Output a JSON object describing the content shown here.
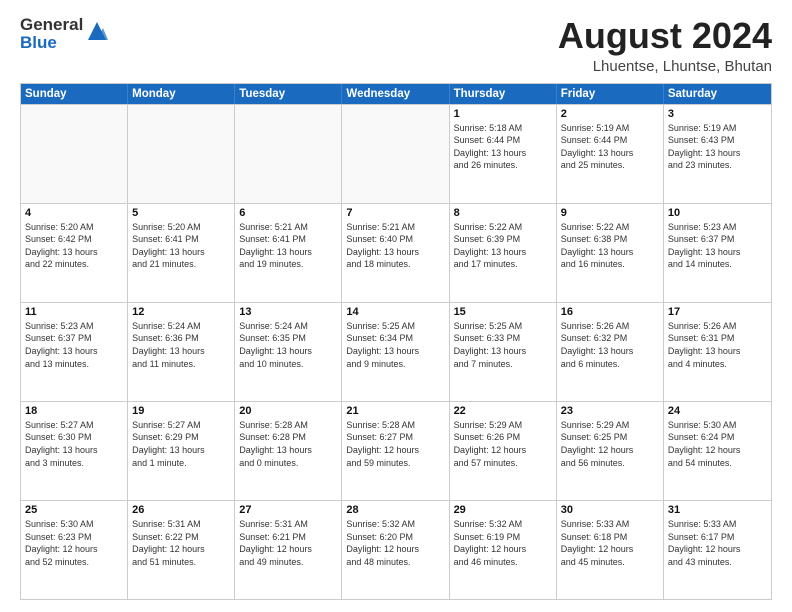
{
  "header": {
    "logo_line1": "General",
    "logo_line2": "Blue",
    "title": "August 2024",
    "subtitle": "Lhuentse, Lhuntse, Bhutan"
  },
  "days_of_week": [
    "Sunday",
    "Monday",
    "Tuesday",
    "Wednesday",
    "Thursday",
    "Friday",
    "Saturday"
  ],
  "weeks": [
    [
      {
        "day": "",
        "info": "",
        "empty": true
      },
      {
        "day": "",
        "info": "",
        "empty": true
      },
      {
        "day": "",
        "info": "",
        "empty": true
      },
      {
        "day": "",
        "info": "",
        "empty": true
      },
      {
        "day": "1",
        "info": "Sunrise: 5:18 AM\nSunset: 6:44 PM\nDaylight: 13 hours\nand 26 minutes.",
        "empty": false
      },
      {
        "day": "2",
        "info": "Sunrise: 5:19 AM\nSunset: 6:44 PM\nDaylight: 13 hours\nand 25 minutes.",
        "empty": false
      },
      {
        "day": "3",
        "info": "Sunrise: 5:19 AM\nSunset: 6:43 PM\nDaylight: 13 hours\nand 23 minutes.",
        "empty": false
      }
    ],
    [
      {
        "day": "4",
        "info": "Sunrise: 5:20 AM\nSunset: 6:42 PM\nDaylight: 13 hours\nand 22 minutes.",
        "empty": false
      },
      {
        "day": "5",
        "info": "Sunrise: 5:20 AM\nSunset: 6:41 PM\nDaylight: 13 hours\nand 21 minutes.",
        "empty": false
      },
      {
        "day": "6",
        "info": "Sunrise: 5:21 AM\nSunset: 6:41 PM\nDaylight: 13 hours\nand 19 minutes.",
        "empty": false
      },
      {
        "day": "7",
        "info": "Sunrise: 5:21 AM\nSunset: 6:40 PM\nDaylight: 13 hours\nand 18 minutes.",
        "empty": false
      },
      {
        "day": "8",
        "info": "Sunrise: 5:22 AM\nSunset: 6:39 PM\nDaylight: 13 hours\nand 17 minutes.",
        "empty": false
      },
      {
        "day": "9",
        "info": "Sunrise: 5:22 AM\nSunset: 6:38 PM\nDaylight: 13 hours\nand 16 minutes.",
        "empty": false
      },
      {
        "day": "10",
        "info": "Sunrise: 5:23 AM\nSunset: 6:37 PM\nDaylight: 13 hours\nand 14 minutes.",
        "empty": false
      }
    ],
    [
      {
        "day": "11",
        "info": "Sunrise: 5:23 AM\nSunset: 6:37 PM\nDaylight: 13 hours\nand 13 minutes.",
        "empty": false
      },
      {
        "day": "12",
        "info": "Sunrise: 5:24 AM\nSunset: 6:36 PM\nDaylight: 13 hours\nand 11 minutes.",
        "empty": false
      },
      {
        "day": "13",
        "info": "Sunrise: 5:24 AM\nSunset: 6:35 PM\nDaylight: 13 hours\nand 10 minutes.",
        "empty": false
      },
      {
        "day": "14",
        "info": "Sunrise: 5:25 AM\nSunset: 6:34 PM\nDaylight: 13 hours\nand 9 minutes.",
        "empty": false
      },
      {
        "day": "15",
        "info": "Sunrise: 5:25 AM\nSunset: 6:33 PM\nDaylight: 13 hours\nand 7 minutes.",
        "empty": false
      },
      {
        "day": "16",
        "info": "Sunrise: 5:26 AM\nSunset: 6:32 PM\nDaylight: 13 hours\nand 6 minutes.",
        "empty": false
      },
      {
        "day": "17",
        "info": "Sunrise: 5:26 AM\nSunset: 6:31 PM\nDaylight: 13 hours\nand 4 minutes.",
        "empty": false
      }
    ],
    [
      {
        "day": "18",
        "info": "Sunrise: 5:27 AM\nSunset: 6:30 PM\nDaylight: 13 hours\nand 3 minutes.",
        "empty": false
      },
      {
        "day": "19",
        "info": "Sunrise: 5:27 AM\nSunset: 6:29 PM\nDaylight: 13 hours\nand 1 minute.",
        "empty": false
      },
      {
        "day": "20",
        "info": "Sunrise: 5:28 AM\nSunset: 6:28 PM\nDaylight: 13 hours\nand 0 minutes.",
        "empty": false
      },
      {
        "day": "21",
        "info": "Sunrise: 5:28 AM\nSunset: 6:27 PM\nDaylight: 12 hours\nand 59 minutes.",
        "empty": false
      },
      {
        "day": "22",
        "info": "Sunrise: 5:29 AM\nSunset: 6:26 PM\nDaylight: 12 hours\nand 57 minutes.",
        "empty": false
      },
      {
        "day": "23",
        "info": "Sunrise: 5:29 AM\nSunset: 6:25 PM\nDaylight: 12 hours\nand 56 minutes.",
        "empty": false
      },
      {
        "day": "24",
        "info": "Sunrise: 5:30 AM\nSunset: 6:24 PM\nDaylight: 12 hours\nand 54 minutes.",
        "empty": false
      }
    ],
    [
      {
        "day": "25",
        "info": "Sunrise: 5:30 AM\nSunset: 6:23 PM\nDaylight: 12 hours\nand 52 minutes.",
        "empty": false
      },
      {
        "day": "26",
        "info": "Sunrise: 5:31 AM\nSunset: 6:22 PM\nDaylight: 12 hours\nand 51 minutes.",
        "empty": false
      },
      {
        "day": "27",
        "info": "Sunrise: 5:31 AM\nSunset: 6:21 PM\nDaylight: 12 hours\nand 49 minutes.",
        "empty": false
      },
      {
        "day": "28",
        "info": "Sunrise: 5:32 AM\nSunset: 6:20 PM\nDaylight: 12 hours\nand 48 minutes.",
        "empty": false
      },
      {
        "day": "29",
        "info": "Sunrise: 5:32 AM\nSunset: 6:19 PM\nDaylight: 12 hours\nand 46 minutes.",
        "empty": false
      },
      {
        "day": "30",
        "info": "Sunrise: 5:33 AM\nSunset: 6:18 PM\nDaylight: 12 hours\nand 45 minutes.",
        "empty": false
      },
      {
        "day": "31",
        "info": "Sunrise: 5:33 AM\nSunset: 6:17 PM\nDaylight: 12 hours\nand 43 minutes.",
        "empty": false
      }
    ]
  ]
}
